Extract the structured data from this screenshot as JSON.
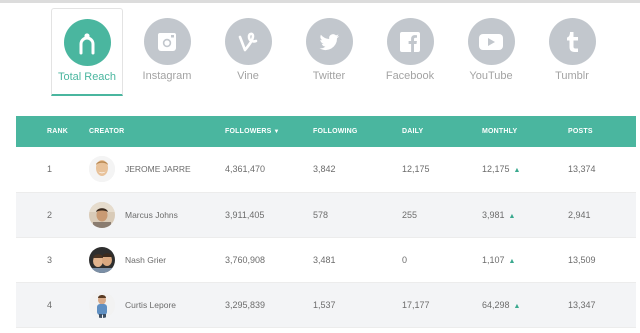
{
  "tabs": [
    {
      "label": "Total Reach",
      "icon": "person-icon",
      "active": true
    },
    {
      "label": "Instagram",
      "icon": "instagram-icon",
      "active": false
    },
    {
      "label": "Vine",
      "icon": "vine-icon",
      "active": false
    },
    {
      "label": "Twitter",
      "icon": "twitter-icon",
      "active": false
    },
    {
      "label": "Facebook",
      "icon": "facebook-icon",
      "active": false
    },
    {
      "label": "YouTube",
      "icon": "youtube-icon",
      "active": false
    },
    {
      "label": "Tumblr",
      "icon": "tumblr-icon",
      "active": false
    }
  ],
  "table": {
    "headers": {
      "rank": "RANK",
      "creator": "CREATOR",
      "followers": "FOLLOWERS",
      "following": "FOLLOWING",
      "daily": "DAILY",
      "monthly": "MONTHLY",
      "posts": "POSTS"
    },
    "sort_indicator": "▼",
    "trend_indicator": "▲",
    "rows": [
      {
        "rank": "1",
        "name": "JEROME JARRE",
        "followers": "4,361,470",
        "following": "3,842",
        "daily": "12,175",
        "monthly": "12,175",
        "posts": "13,374"
      },
      {
        "rank": "2",
        "name": "Marcus Johns",
        "followers": "3,911,405",
        "following": "578",
        "daily": "255",
        "monthly": "3,981",
        "posts": "2,941"
      },
      {
        "rank": "3",
        "name": "Nash Grier",
        "followers": "3,760,908",
        "following": "3,481",
        "daily": "0",
        "monthly": "1,107",
        "posts": "13,509"
      },
      {
        "rank": "4",
        "name": "Curtis Lepore",
        "followers": "3,295,839",
        "following": "1,537",
        "daily": "17,177",
        "monthly": "64,298",
        "posts": "13,347"
      }
    ]
  },
  "colors": {
    "accent": "#4ab69f",
    "icon_inactive": "#c2c7cd",
    "row_alt": "#f3f4f6",
    "trend_up": "#3aa98e"
  }
}
